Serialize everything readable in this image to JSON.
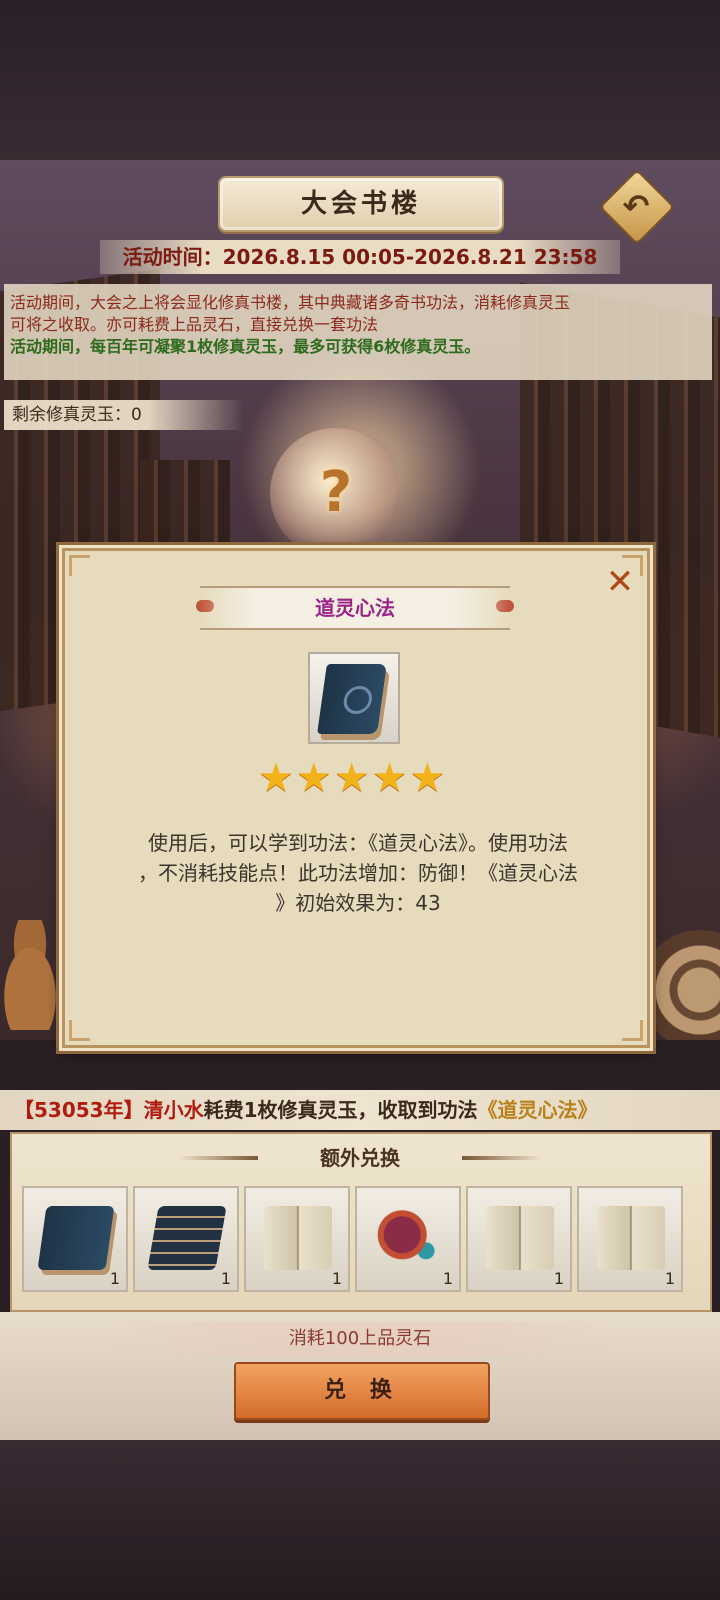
{
  "header": {
    "title": "大会书楼",
    "back_icon": "back-arrow-icon"
  },
  "activity": {
    "time_label": "活动时间：2026.8.15 00:05-2026.8.21 23:58",
    "desc_line1": "活动期间，大会之上将会显化修真书楼，其中典藏诸多奇书功法，消耗修真灵玉",
    "desc_line2": "可将之收取。亦可耗费上品灵石，直接兑换一套功法",
    "desc_line3": "活动期间，每百年可凝聚1枚修真灵玉，最多可获得6枚修真灵玉。",
    "remaining": "剩余修真灵玉：0"
  },
  "scene": {
    "center_glyph": "?"
  },
  "modal": {
    "close_icon": "close-icon",
    "close_glyph": "✕",
    "item_name": "道灵心法",
    "stars": [
      "★",
      "★",
      "★",
      "★",
      "★"
    ],
    "desc_line1": "使用后，可以学到功法：《道灵心法》。使用功法",
    "desc_line2": "，不消耗技能点！此功法增加：防御！《道灵心法",
    "desc_line3": "》初始效果为：43"
  },
  "log": {
    "open_bracket": "【",
    "year": "53053年",
    "close_bracket": "】",
    "name": "清小水",
    "action": "耗费1枚修真灵玉，收取到功法",
    "item": "《道灵心法》"
  },
  "extra": {
    "title": "额外兑换",
    "slots": [
      {
        "icon": "blue-book-icon",
        "count": "1"
      },
      {
        "icon": "book-stack-icon",
        "count": "1"
      },
      {
        "icon": "open-book-icon",
        "count": "1"
      },
      {
        "icon": "scroll-ornament-icon",
        "count": "1"
      },
      {
        "icon": "open-book-icon",
        "count": "1"
      },
      {
        "icon": "open-book-icon",
        "count": "1"
      }
    ],
    "cost": "消耗100上品灵石",
    "button": "兑 换"
  },
  "colors": {
    "accent_red": "#7a1a10",
    "accent_green": "#2f6b1e",
    "item_purple": "#9a2488",
    "button_orange": "#e08846",
    "star_gold": "#f2b21a"
  }
}
